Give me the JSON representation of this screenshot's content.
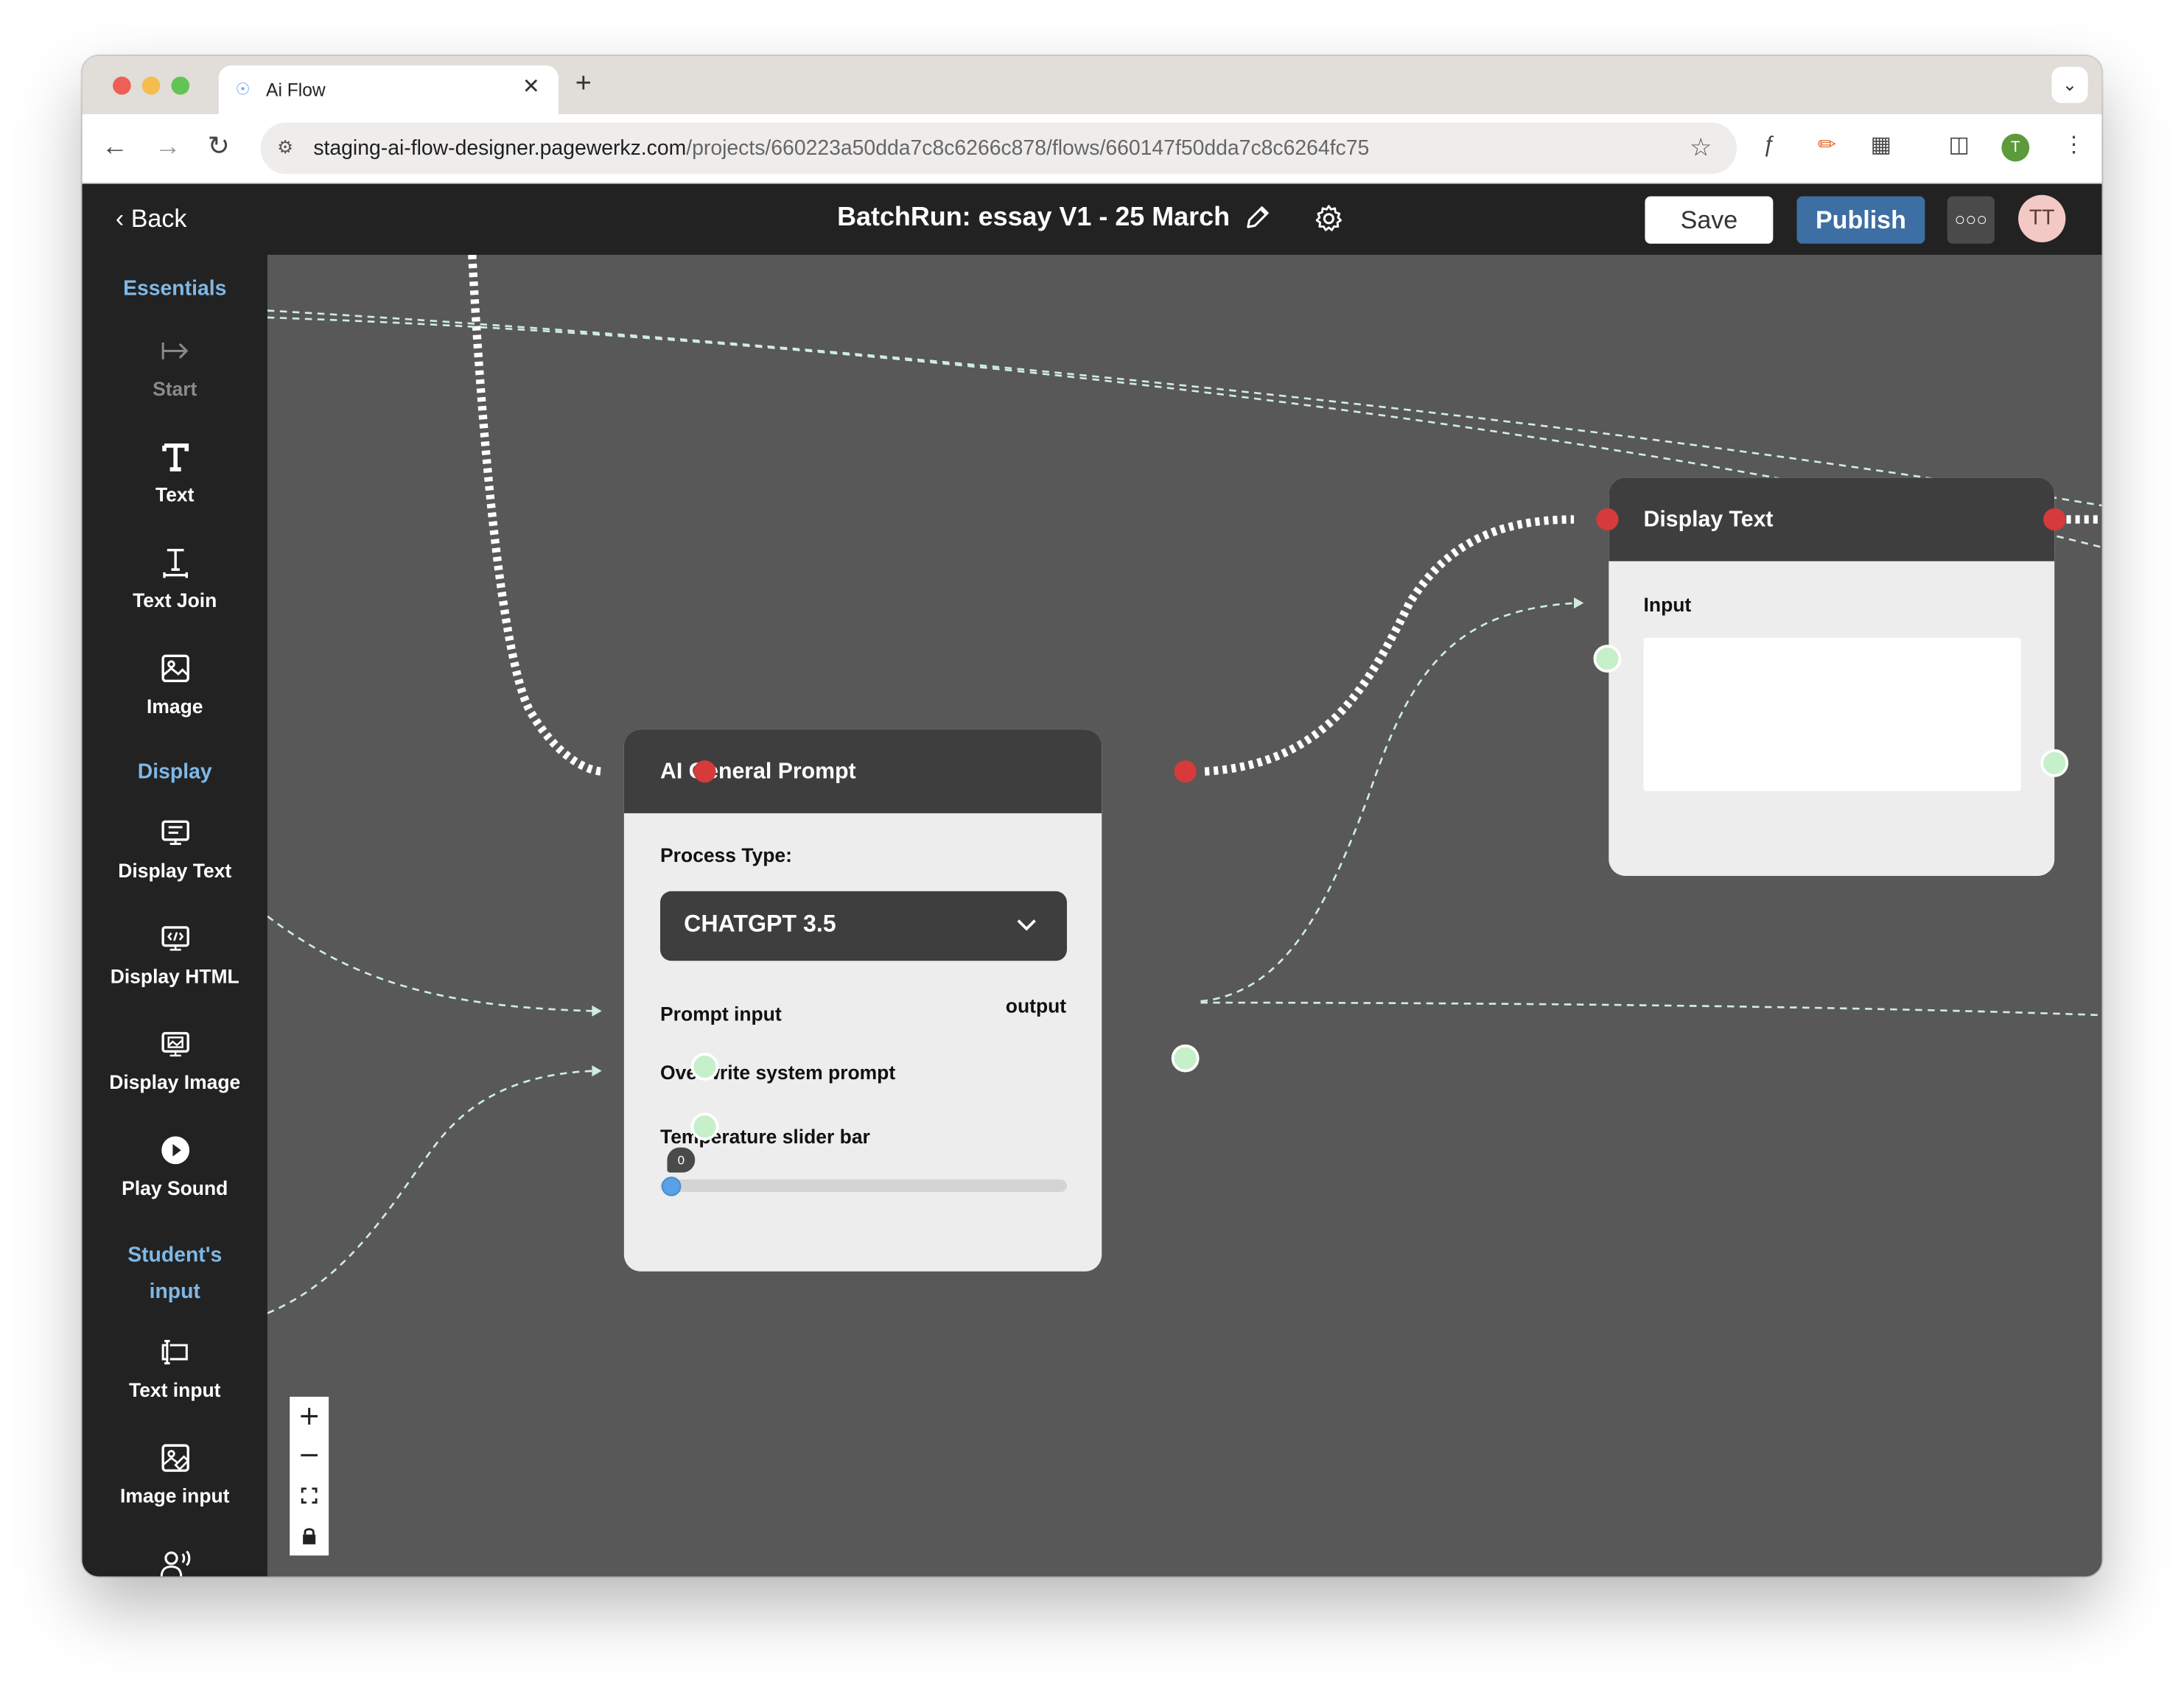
{
  "browser": {
    "tab_title": "Ai Flow",
    "url_host": "staging-ai-flow-designer.pagewerkz.com",
    "url_path": "/projects/660223a50dda7c8c6266c878/flows/660147f50dda7c8c6264fc75",
    "profile_initial": "T"
  },
  "header": {
    "back_label": "Back",
    "title": "BatchRun: essay V1 - 25 March",
    "save_label": "Save",
    "publish_label": "Publish",
    "avatar_initials": "TT"
  },
  "sidebar": {
    "sections": {
      "essentials": "Essentials",
      "display": "Display",
      "student_input_line1": "Student's",
      "student_input_line2": "input"
    },
    "items": {
      "start": "Start",
      "text": "Text",
      "text_join": "Text Join",
      "image": "Image",
      "display_text": "Display Text",
      "display_html": "Display HTML",
      "display_image": "Display Image",
      "play_sound": "Play Sound",
      "text_input": "Text input",
      "image_input": "Image input"
    }
  },
  "nodes": {
    "ai_prompt": {
      "title": "AI General Prompt",
      "process_type_label": "Process Type:",
      "process_type_value": "CHATGPT 3.5",
      "prompt_input_label": "Prompt input",
      "overwrite_label": "Overwrite system prompt",
      "output_label": "output",
      "temperature_label": "Temperature slider bar",
      "temperature_value": "0"
    },
    "display_text": {
      "title": "Display Text",
      "input_label": "Input",
      "input_value": ""
    }
  },
  "colors": {
    "canvas": "#585858",
    "header": "#222222",
    "publish": "#3d6fa5",
    "accent_section": "#7fb8e6",
    "port_exec": "#d63a3a",
    "port_data": "#c6f0c9"
  }
}
